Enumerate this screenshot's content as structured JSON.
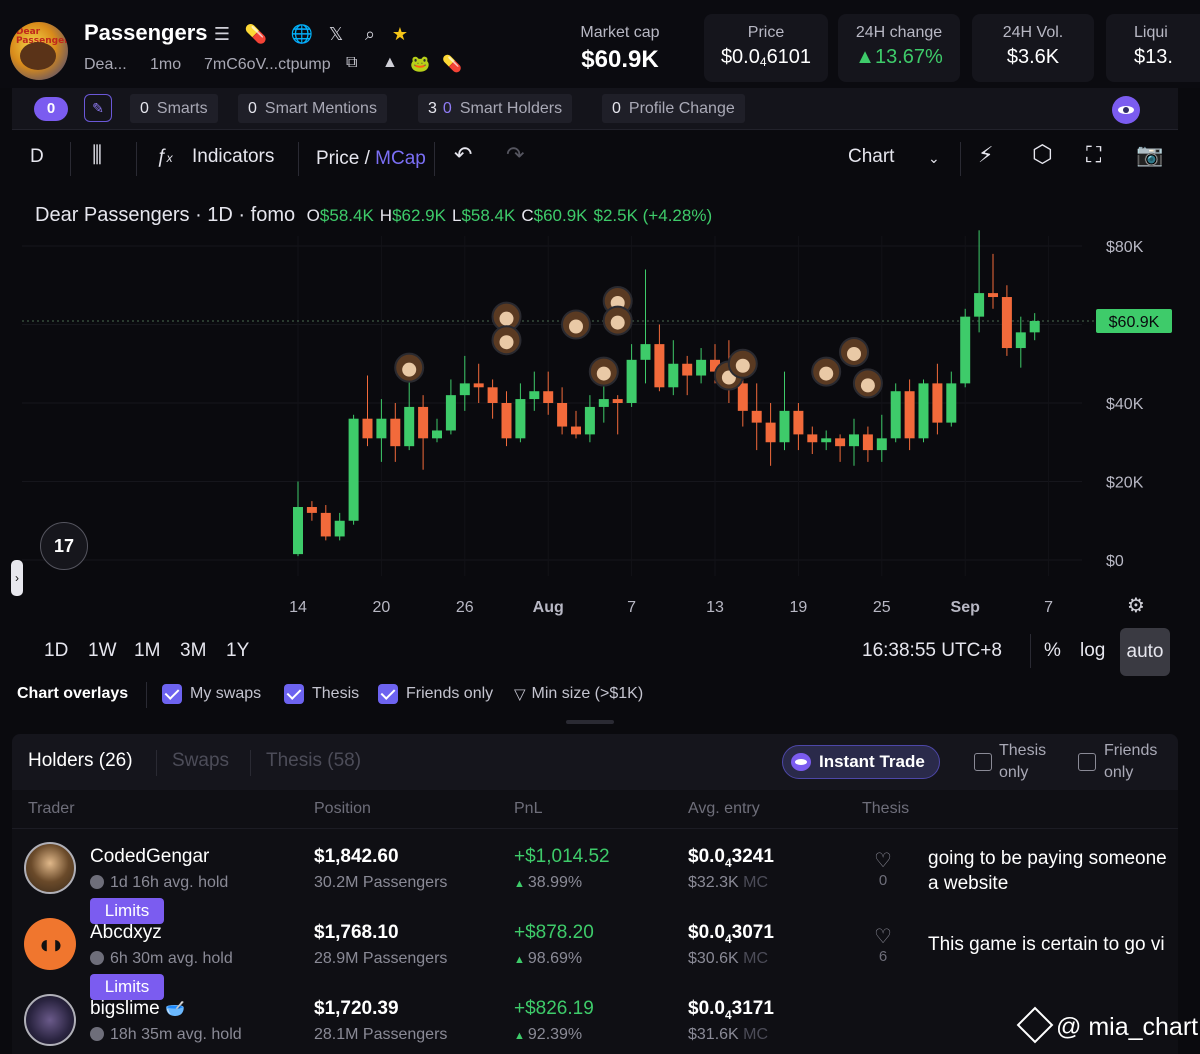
{
  "token": {
    "name": "Passengers",
    "short": "Dea...",
    "age": "1mo",
    "address": "7mC6oV...ctpump",
    "avatar_text": "Dear Passengers"
  },
  "stats": [
    {
      "label": "Market cap",
      "value": "$60.9K"
    },
    {
      "label": "Price",
      "value_pre": "$0.0",
      "value_sub": "4",
      "value_post": "6101"
    },
    {
      "label": "24H change",
      "value": "▲13.67%"
    },
    {
      "label": "24H Vol.",
      "value": "$3.6K"
    },
    {
      "label": "Liqui",
      "value": "$13."
    }
  ],
  "smartbar": {
    "count": "0",
    "chips": [
      {
        "count": "0",
        "label": "Smarts"
      },
      {
        "count": "0",
        "label": "Smart Mentions"
      },
      {
        "count": "3",
        "count2": "0",
        "label": "Smart Holders"
      },
      {
        "count": "0",
        "label": "Profile Change"
      }
    ]
  },
  "toolbar": {
    "interval": "D",
    "indicators": "Indicators",
    "price": "Price",
    "slash": " / ",
    "mcap": "MCap",
    "chart_type": "Chart"
  },
  "legend": {
    "title": "Dear Passengers · 1D · fomo",
    "o_key": "O",
    "o": "$58.4K",
    "h_key": "H",
    "h": "$62.9K",
    "l_key": "L",
    "l": "$58.4K",
    "c_key": "C",
    "c": "$60.9K",
    "change": "$2.5K (+4.28%)"
  },
  "chart_data": {
    "type": "candlestick",
    "ylim": [
      0,
      80000
    ],
    "y_ticks": [
      {
        "v": 0,
        "label": "$0"
      },
      {
        "v": 20000,
        "label": "$20K"
      },
      {
        "v": 40000,
        "label": "$40K"
      },
      {
        "v": 80000,
        "label": "$80K"
      }
    ],
    "last_price": 60900,
    "last_price_label": "$60.9K",
    "x_ticks": [
      {
        "i": 0,
        "label": "14"
      },
      {
        "i": 6,
        "label": "20"
      },
      {
        "i": 12,
        "label": "26"
      },
      {
        "i": 18,
        "label": "Aug"
      },
      {
        "i": 24,
        "label": "7"
      },
      {
        "i": 30,
        "label": "13"
      },
      {
        "i": 36,
        "label": "19"
      },
      {
        "i": 42,
        "label": "25"
      },
      {
        "i": 48,
        "label": "Sep"
      },
      {
        "i": 54,
        "label": "7"
      }
    ],
    "candles": [
      [
        1500,
        13500,
        1000,
        20000
      ],
      [
        13500,
        12000,
        10000,
        15000
      ],
      [
        12000,
        6000,
        5000,
        14000
      ],
      [
        6000,
        10000,
        5000,
        12000
      ],
      [
        10000,
        36000,
        9000,
        37000
      ],
      [
        36000,
        31000,
        29000,
        47000
      ],
      [
        31000,
        36000,
        25000,
        41000
      ],
      [
        36000,
        29000,
        25000,
        40000
      ],
      [
        29000,
        39000,
        28000,
        46000
      ],
      [
        39000,
        31000,
        23000,
        42000
      ],
      [
        31000,
        33000,
        30000,
        36000
      ],
      [
        33000,
        42000,
        32000,
        46000
      ],
      [
        42000,
        45000,
        38000,
        52000
      ],
      [
        45000,
        44000,
        40000,
        50000
      ],
      [
        44000,
        40000,
        36000,
        46000
      ],
      [
        40000,
        31000,
        29000,
        43000
      ],
      [
        31000,
        41000,
        30000,
        45000
      ],
      [
        41000,
        43000,
        38000,
        48000
      ],
      [
        43000,
        40000,
        37000,
        48000
      ],
      [
        40000,
        34000,
        32000,
        44000
      ],
      [
        34000,
        32000,
        31000,
        38000
      ],
      [
        32000,
        39000,
        30000,
        42000
      ],
      [
        39000,
        41000,
        35000,
        45000
      ],
      [
        41000,
        40000,
        32000,
        42000
      ],
      [
        40000,
        51000,
        39000,
        55000
      ],
      [
        51000,
        55000,
        45000,
        74000
      ],
      [
        55000,
        44000,
        43000,
        60000
      ],
      [
        44000,
        50000,
        42000,
        56000
      ],
      [
        50000,
        47000,
        42000,
        52000
      ],
      [
        47000,
        51000,
        45000,
        54000
      ],
      [
        51000,
        48000,
        45000,
        55000
      ],
      [
        48000,
        45000,
        40000,
        56000
      ],
      [
        45000,
        38000,
        34000,
        50000
      ],
      [
        38000,
        35000,
        28000,
        45000
      ],
      [
        35000,
        30000,
        24000,
        40000
      ],
      [
        30000,
        38000,
        28000,
        48000
      ],
      [
        38000,
        32000,
        28000,
        40000
      ],
      [
        32000,
        30000,
        27000,
        34000
      ],
      [
        30000,
        31000,
        28000,
        33000
      ],
      [
        31000,
        29000,
        25000,
        32000
      ],
      [
        29000,
        32000,
        24000,
        36000
      ],
      [
        32000,
        28000,
        25000,
        34000
      ],
      [
        28000,
        31000,
        25000,
        37000
      ],
      [
        31000,
        43000,
        30000,
        45000
      ],
      [
        43000,
        31000,
        28000,
        46000
      ],
      [
        31000,
        45000,
        30000,
        46000
      ],
      [
        45000,
        35000,
        32000,
        50000
      ],
      [
        35000,
        45000,
        34000,
        48000
      ],
      [
        45000,
        62000,
        44000,
        64000
      ],
      [
        62000,
        68000,
        58000,
        84000
      ],
      [
        68000,
        67000,
        64000,
        78000
      ],
      [
        67000,
        54000,
        52000,
        70000
      ],
      [
        54000,
        58000,
        49000,
        62000
      ],
      [
        58000,
        60900,
        56000,
        62900
      ]
    ],
    "markers": [
      {
        "i": 8,
        "v": 49000
      },
      {
        "i": 15,
        "v": 62000
      },
      {
        "i": 15,
        "v": 56000
      },
      {
        "i": 20,
        "v": 60000
      },
      {
        "i": 22,
        "v": 48000
      },
      {
        "i": 23,
        "v": 66000
      },
      {
        "i": 23,
        "v": 61000
      },
      {
        "i": 31,
        "v": 47000
      },
      {
        "i": 32,
        "v": 50000
      },
      {
        "i": 38,
        "v": 48000
      },
      {
        "i": 40,
        "v": 53000
      },
      {
        "i": 41,
        "v": 45000
      }
    ]
  },
  "ranges": [
    "1D",
    "1W",
    "1M",
    "3M",
    "1Y"
  ],
  "chart_footer": {
    "time": "16:38:55 UTC+8",
    "percent": "%",
    "log": "log",
    "auto": "auto"
  },
  "overlays": {
    "label": "Chart overlays",
    "items": [
      "My swaps",
      "Thesis",
      "Friends only"
    ],
    "min_size": "Min size (>$1K)"
  },
  "panel": {
    "tabs": [
      "Holders (26)",
      "Swaps",
      "Thesis (58)"
    ],
    "instant_trade": "Instant Trade",
    "opt1_a": "Thesis",
    "opt1_b": "only",
    "opt2_a": "Friends",
    "opt2_b": "only",
    "columns": [
      "Trader",
      "Position",
      "PnL",
      "Avg. entry",
      "Thesis"
    ]
  },
  "holders": [
    {
      "name": "CodedGengar",
      "hold": "1d 16h avg. hold",
      "position": "$1,842.60",
      "amount": "30.2M Passengers",
      "pnl": "+$1,014.52",
      "pnl_pct": "38.99%",
      "avg_pre": "$0.0",
      "avg_sub": "4",
      "avg_post": "3241",
      "avg_mc": "$32.3K",
      "mc": "MC",
      "likes": "0",
      "thesis_1": "going to be paying someone",
      "thesis_2": "a website",
      "limits": "Limits"
    },
    {
      "name": "Abcdxyz",
      "hold": "6h 30m avg. hold",
      "position": "$1,768.10",
      "amount": "28.9M Passengers",
      "pnl": "+$878.20",
      "pnl_pct": "98.69%",
      "avg_pre": "$0.0",
      "avg_sub": "4",
      "avg_post": "3071",
      "avg_mc": "$30.6K",
      "mc": "MC",
      "likes": "6",
      "thesis_1": "This game is certain to go vi",
      "limits": "Limits"
    },
    {
      "name": "bigslime",
      "hold": "18h 35m avg. hold",
      "position": "$1,720.39",
      "amount": "28.1M Passengers",
      "pnl": "+$826.19",
      "pnl_pct": "92.39%",
      "avg_pre": "$0.0",
      "avg_sub": "4",
      "avg_post": "3171",
      "avg_mc": "$31.6K",
      "mc": "MC"
    }
  ],
  "watermark": "@ mia_chart",
  "colors": {
    "green": "#3ecb6a",
    "red": "#f26a3b",
    "accent": "#7b5cf0"
  }
}
